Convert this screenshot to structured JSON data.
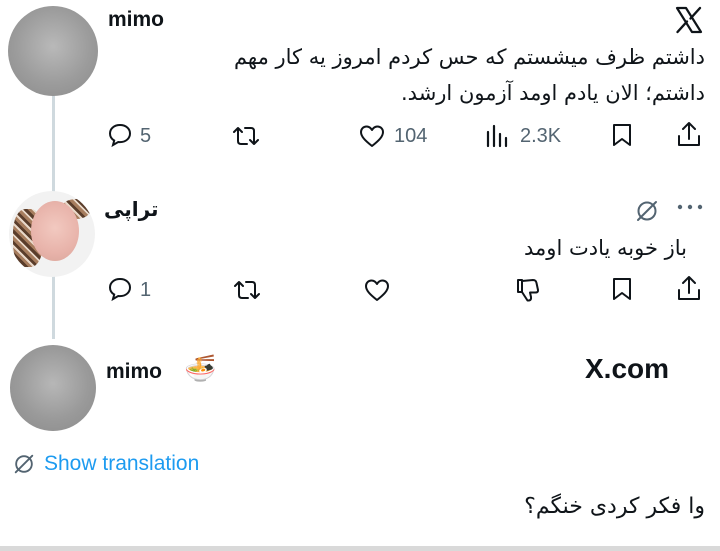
{
  "tweet1": {
    "username": "mimo",
    "text_line1": "داشتم ظرف میشستم که حس کردم امروز یه کار مهم",
    "text_line2": "داشتم؛ الان یادم اومد آزمون ارشد.",
    "reply_count": "5",
    "like_count": "104",
    "view_count": "2.3K"
  },
  "reply": {
    "username": "تراپی",
    "text": "باز خوبه یادت اومد",
    "reply_count": "1"
  },
  "footer": {
    "username": "mimo",
    "emoji": "🍜",
    "site": "X.com",
    "show_translation": "Show translation",
    "text": "وا فکر کردی خنگم؟"
  },
  "icons": {
    "x_logo": "x-logo-icon",
    "reply": "speech-bubble-icon",
    "retweet": "retweet-icon",
    "like": "heart-icon",
    "views": "bar-chart-icon",
    "bookmark": "bookmark-icon",
    "share": "share-icon",
    "dislike": "thumbs-down-icon",
    "grok": "slash-circle-icon",
    "more": "ellipsis-icon",
    "translate": "globe-icon"
  },
  "colors": {
    "link_blue": "#1d9bf0",
    "muted_gray": "#536471",
    "thread_line": "#cfd9de"
  }
}
